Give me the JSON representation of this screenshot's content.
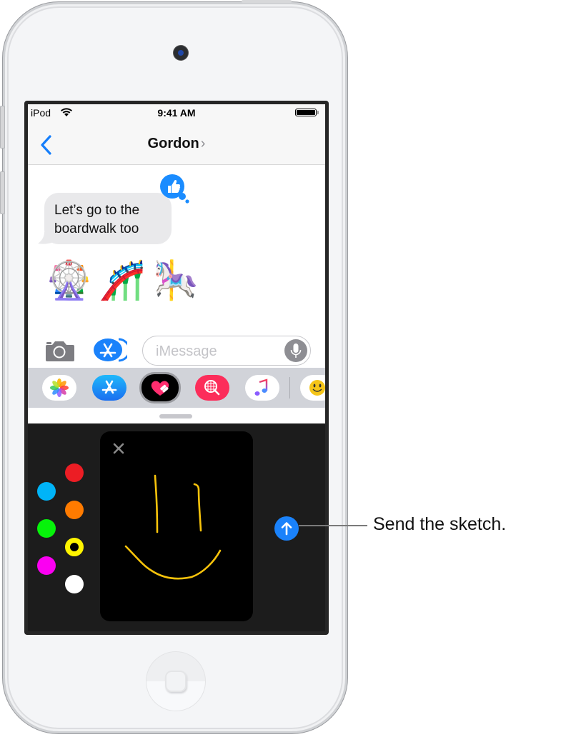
{
  "status_bar": {
    "carrier": "iPod",
    "time": "9:41 AM",
    "battery_percent": 100
  },
  "nav": {
    "title": "Gordon",
    "title_chevron": "›",
    "back_icon": "chevron-left-icon"
  },
  "conversation": {
    "message": "Let’s go to the boardwalk too",
    "message_lines": [
      "Let’s go to the",
      "boardwalk too"
    ],
    "tapback": "thumbs-up",
    "emoji": "🎡🎢🎠"
  },
  "composer": {
    "placeholder": "iMessage",
    "value": "",
    "camera_icon": "camera-icon",
    "apps_icon": "app-store-icon",
    "mic_icon": "microphone-icon"
  },
  "app_drawer": {
    "items": [
      {
        "name": "Photos",
        "icon": "photos-icon"
      },
      {
        "name": "App Store",
        "icon": "app-store-icon"
      },
      {
        "name": "Digital Touch",
        "icon": "digital-touch-heart-icon",
        "selected": true
      },
      {
        "name": "Images Search",
        "icon": "globe-search-icon"
      },
      {
        "name": "Music",
        "icon": "music-note-icon"
      },
      {
        "name": "Animoji",
        "icon": "smiley-icon"
      }
    ]
  },
  "sketch": {
    "colors": [
      {
        "name": "red",
        "hex": "#ec1d24"
      },
      {
        "name": "blue",
        "hex": "#00b4f8"
      },
      {
        "name": "orange",
        "hex": "#ff7b00"
      },
      {
        "name": "green",
        "hex": "#06f30a"
      },
      {
        "name": "yellow",
        "hex": "#fef400",
        "selected": true
      },
      {
        "name": "magenta",
        "hex": "#fb00f2"
      },
      {
        "name": "white",
        "hex": "#ffffff"
      }
    ],
    "stroke_color": "#f7c30b",
    "close_icon": "close-icon",
    "send_icon": "arrow-up-icon"
  },
  "callout": {
    "text": "Send the sketch."
  },
  "colors": {
    "accent": "#1a82fb",
    "bubble_gray": "#e9e9eb",
    "panel_dark": "#1c1c1c"
  }
}
